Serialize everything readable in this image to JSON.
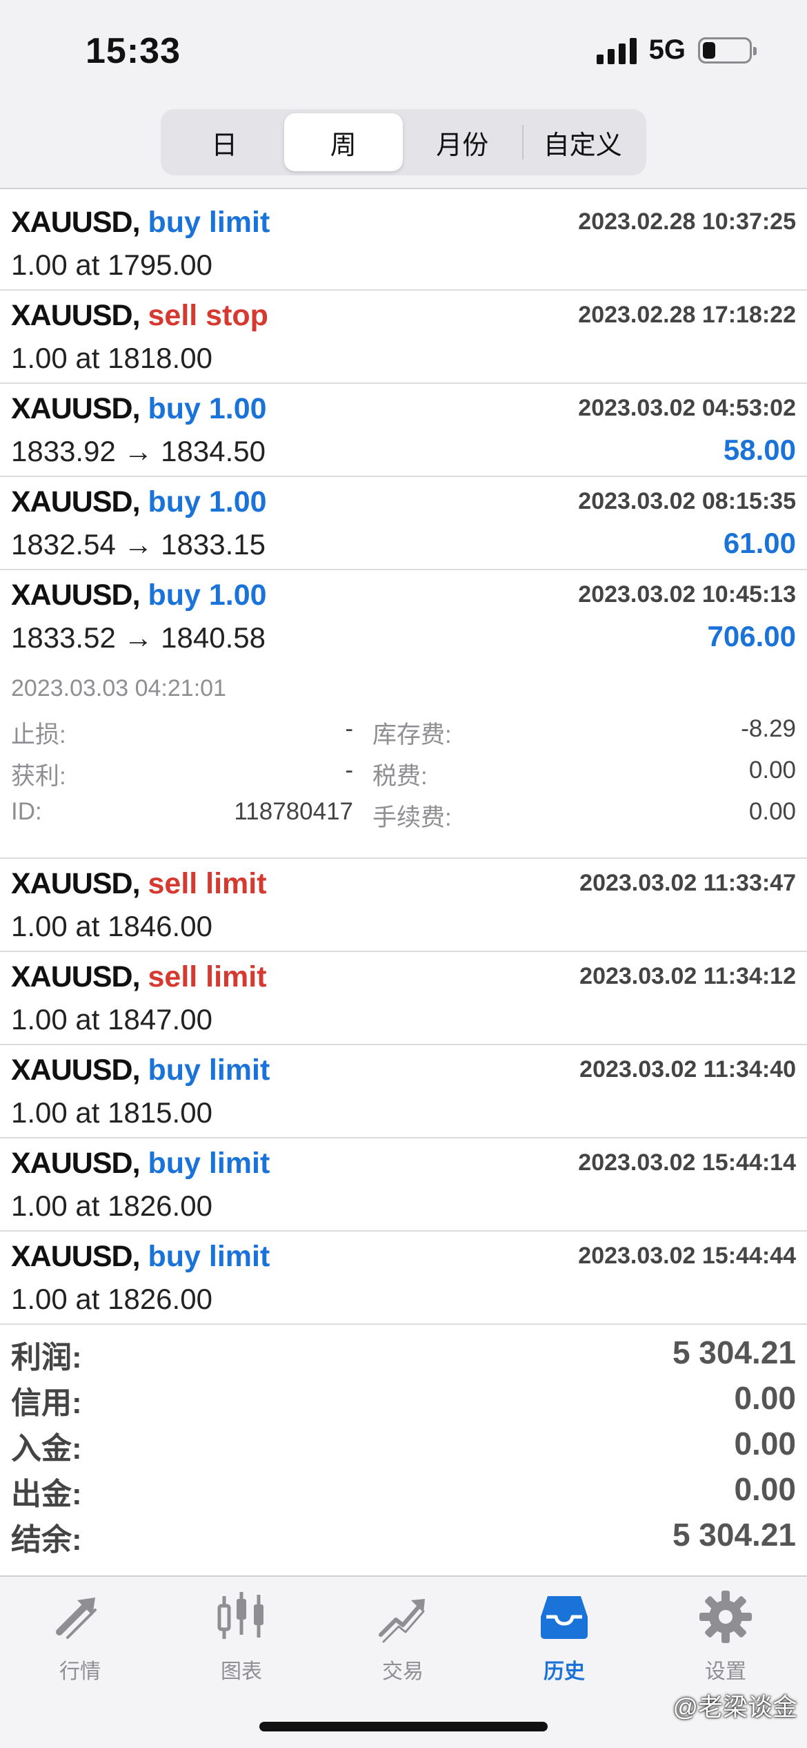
{
  "status_bar": {
    "time": "15:33",
    "network": "5G"
  },
  "segments": [
    {
      "label": "日",
      "active": false
    },
    {
      "label": "周",
      "active": true
    },
    {
      "label": "月份",
      "active": false
    },
    {
      "label": "自定义",
      "active": false
    }
  ],
  "orders": [
    {
      "symbol": "XAUUSD,",
      "action": "buy limit",
      "side": "buy",
      "time": "2023.02.28 10:37:25",
      "detail": "1.00 at 1795.00",
      "profit": ""
    },
    {
      "symbol": "XAUUSD,",
      "action": "sell stop",
      "side": "sell",
      "time": "2023.02.28 17:18:22",
      "detail": "1.00 at 1818.00",
      "profit": ""
    },
    {
      "symbol": "XAUUSD,",
      "action": "buy 1.00",
      "side": "buy",
      "time": "2023.03.02 04:53:02",
      "detail": "1833.92 → 1834.50",
      "profit": "58.00"
    },
    {
      "symbol": "XAUUSD,",
      "action": "buy 1.00",
      "side": "buy",
      "time": "2023.03.02 08:15:35",
      "detail": "1832.54 → 1833.15",
      "profit": "61.00"
    }
  ],
  "expanded": {
    "symbol": "XAUUSD,",
    "action": "buy 1.00",
    "side": "buy",
    "time": "2023.03.02 10:45:13",
    "detail": "1833.52 → 1840.58",
    "profit": "706.00",
    "close_time": "2023.03.03 04:21:01",
    "sl_label": "止损:",
    "sl_value": "-",
    "tp_label": "获利:",
    "tp_value": "-",
    "id_label": "ID:",
    "id_value": "118780417",
    "swap_label": "库存费:",
    "swap_value": "-8.29",
    "tax_label": "税费:",
    "tax_value": "0.00",
    "fee_label": "手续费:",
    "fee_value": "0.00"
  },
  "orders_after": [
    {
      "symbol": "XAUUSD,",
      "action": "sell limit",
      "side": "sell",
      "time": "2023.03.02 11:33:47",
      "detail": "1.00 at 1846.00",
      "profit": ""
    },
    {
      "symbol": "XAUUSD,",
      "action": "sell limit",
      "side": "sell",
      "time": "2023.03.02 11:34:12",
      "detail": "1.00 at 1847.00",
      "profit": ""
    },
    {
      "symbol": "XAUUSD,",
      "action": "buy limit",
      "side": "buy",
      "time": "2023.03.02 11:34:40",
      "detail": "1.00 at 1815.00",
      "profit": ""
    },
    {
      "symbol": "XAUUSD,",
      "action": "buy limit",
      "side": "buy",
      "time": "2023.03.02 15:44:14",
      "detail": "1.00 at 1826.00",
      "profit": ""
    },
    {
      "symbol": "XAUUSD,",
      "action": "buy limit",
      "side": "buy",
      "time": "2023.03.02 15:44:44",
      "detail": "1.00 at 1826.00",
      "profit": ""
    }
  ],
  "summary": [
    {
      "label": "利润:",
      "value": "5 304.21"
    },
    {
      "label": "信用:",
      "value": "0.00"
    },
    {
      "label": "入金:",
      "value": "0.00"
    },
    {
      "label": "出金:",
      "value": "0.00"
    },
    {
      "label": "结余:",
      "value": "5 304.21"
    }
  ],
  "tabs": [
    {
      "label": "行情",
      "icon": "quotes-icon",
      "active": false
    },
    {
      "label": "图表",
      "icon": "chart-icon",
      "active": false
    },
    {
      "label": "交易",
      "icon": "trade-icon",
      "active": false
    },
    {
      "label": "历史",
      "icon": "history-icon",
      "active": true
    },
    {
      "label": "设置",
      "icon": "gear-icon",
      "active": false
    }
  ],
  "watermark": "@老梁谈金",
  "colors": {
    "buy": "#1a73d9",
    "sell": "#d6392f",
    "active_tab": "#1a73d9",
    "inactive_tab": "#8e8e93"
  }
}
